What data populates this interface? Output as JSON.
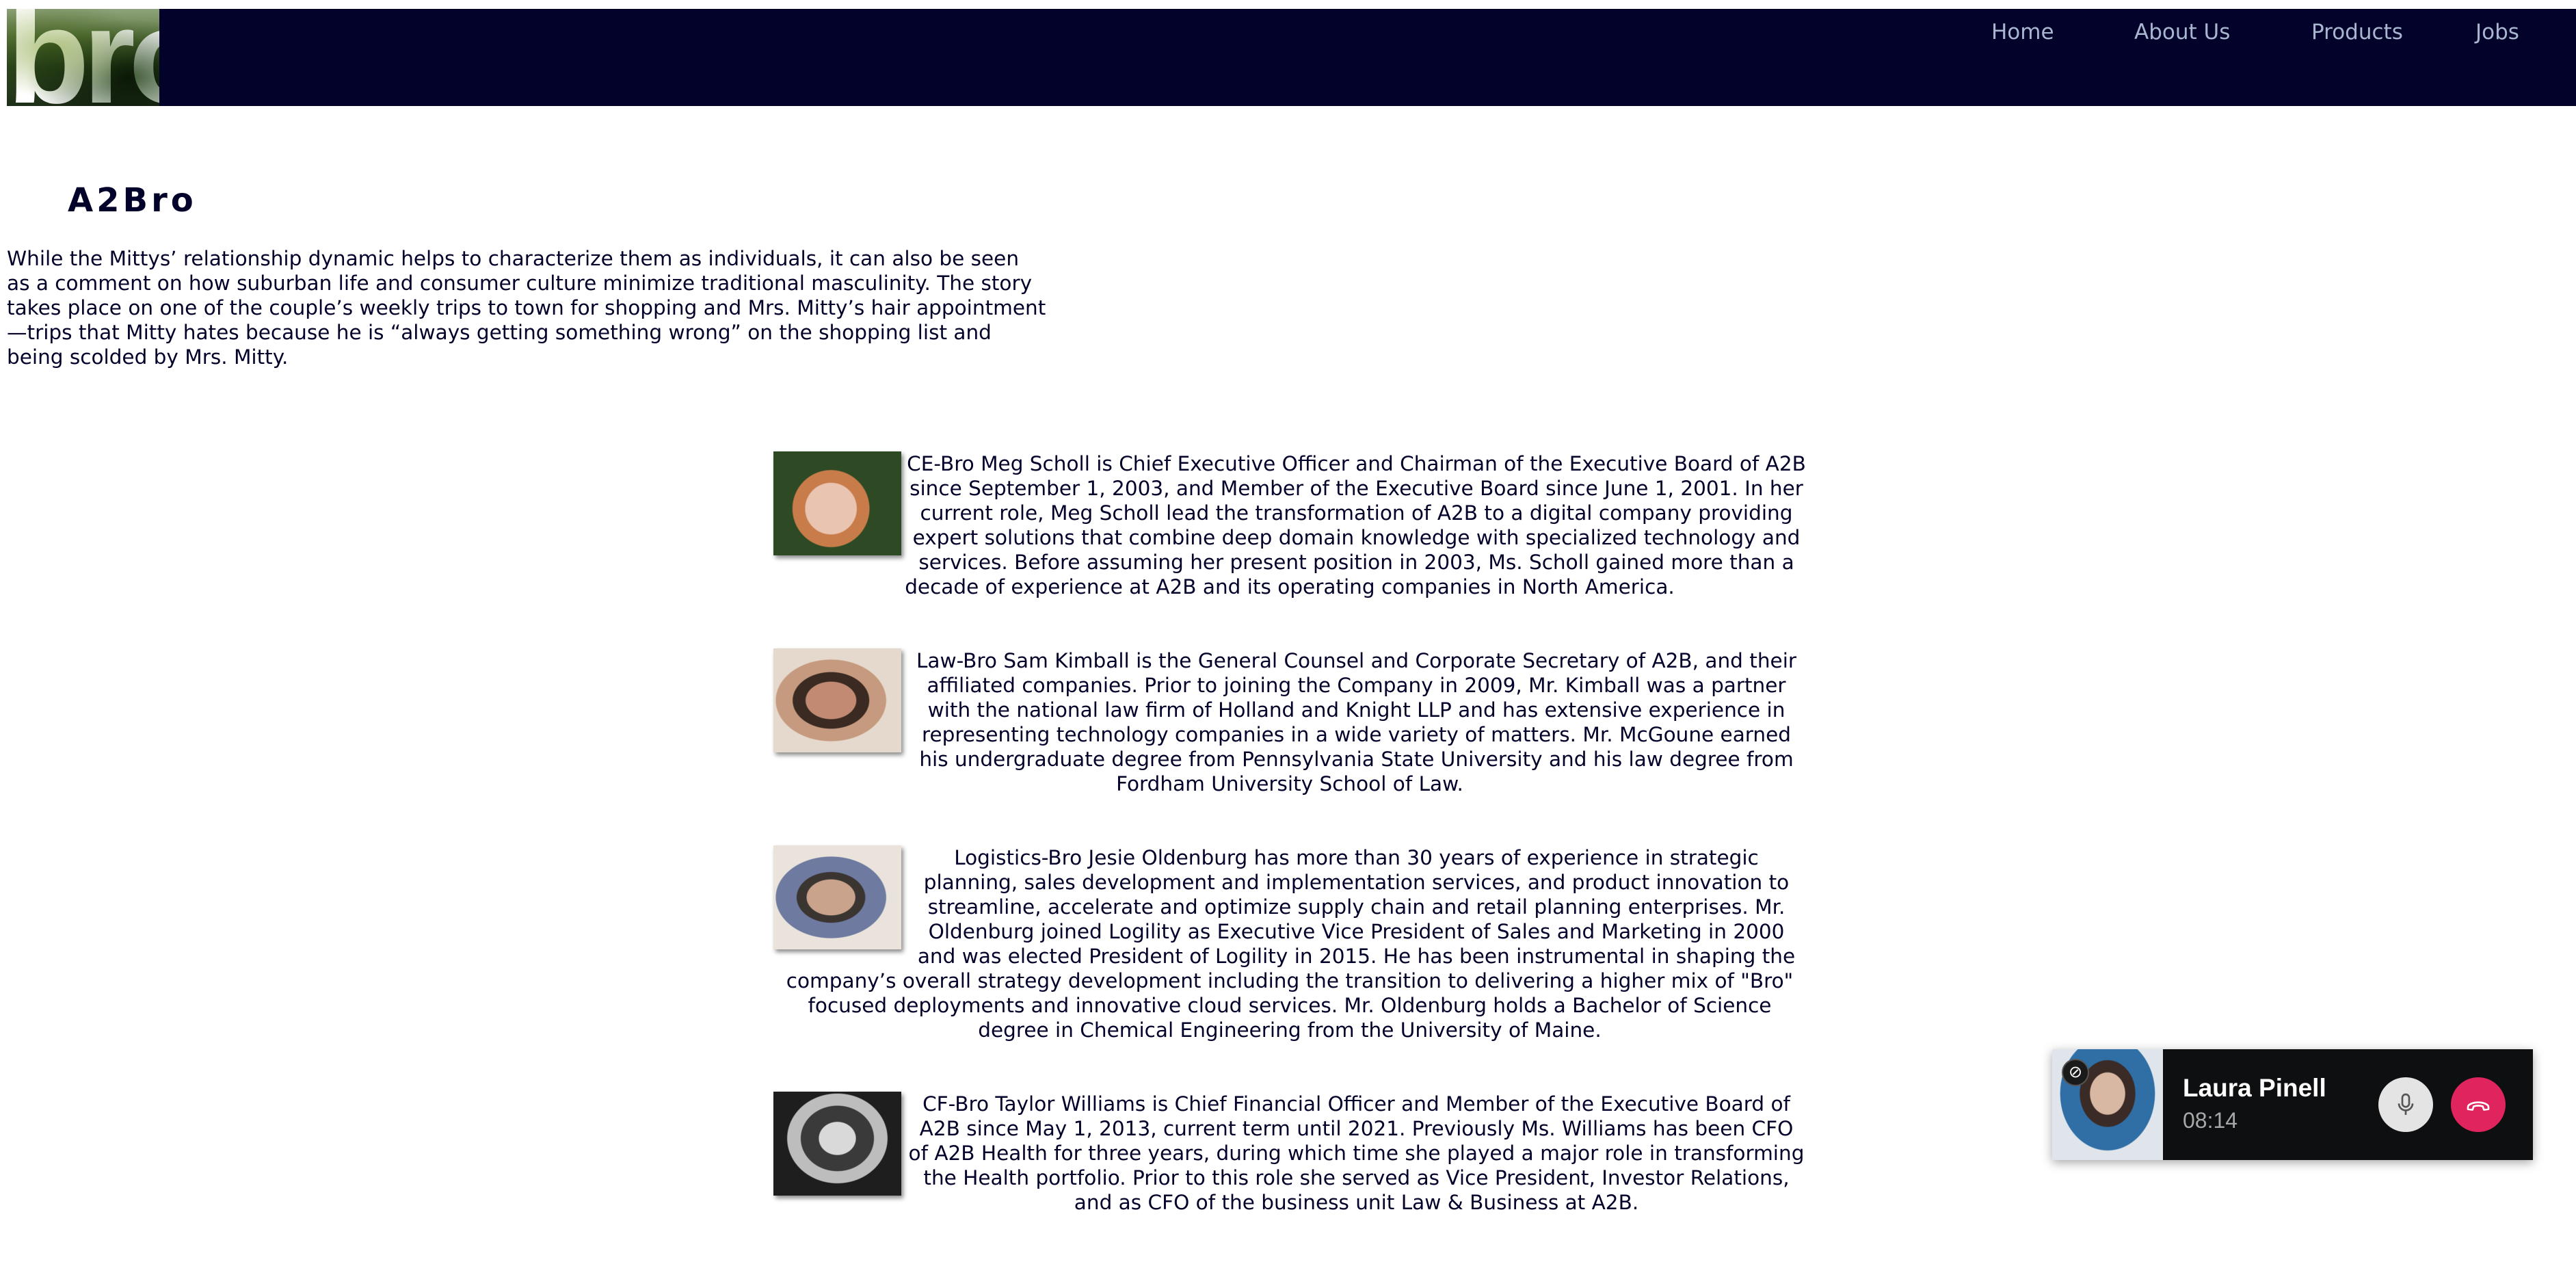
{
  "header": {
    "logo_text": "bro.",
    "nav": [
      {
        "label": "Home"
      },
      {
        "label": "About Us"
      },
      {
        "label": "Products"
      },
      {
        "label": "Jobs"
      }
    ]
  },
  "intro": {
    "title": "A2Bro",
    "text": "While the Mittys’ relationship dynamic helps to characterize them as individuals, it can also be seen as a comment on how suburban life and consumer culture minimize traditional masculinity. The story takes place on one of the couple’s weekly trips to town for shopping and Mrs. Mitty’s hair appointment—trips that Mitty hates because he is “always getting something wrong” on the shopping list and being scolded by Mrs. Mitty."
  },
  "team": [
    {
      "bio": "CE-Bro Meg Scholl is Chief Executive Officer and Chairman of the Executive Board of A2B since September 1, 2003, and Member of the Executive Board since June 1, 2001. In her current role, Meg Scholl lead the transformation of A2B to a digital company providing expert solutions that combine deep domain knowledge with specialized technology and services. Before assuming her present position in 2003, Ms. Scholl gained more than a decade of experience at A2B and its operating companies in North America."
    },
    {
      "bio": "Law-Bro Sam Kimball is the General Counsel and Corporate Secretary of A2B, and their affiliated companies. Prior to joining the Company in 2009, Mr. Kimball was a partner with the national law firm of Holland and Knight LLP and has extensive experience in representing technology companies in a wide variety of matters. Mr. McGoune earned his undergraduate degree from Pennsylvania State University and his law degree from Fordham University School of Law."
    },
    {
      "bio": "Logistics-Bro Jesie Oldenburg has more than 30 years of experience in strategic planning, sales development and implementation services, and product innovation to streamline, accelerate and optimize supply chain and retail planning enterprises. Mr. Oldenburg joined Logility as Executive Vice President of Sales and Marketing in 2000 and was elected President of Logility in 2015. He has been instrumental in shaping the company’s overall strategy development including the transition to delivering a higher mix of \"Bro\" focused deployments and innovative cloud services. Mr. Oldenburg holds a Bachelor of Science degree in Chemical Engineering from the University of Maine."
    },
    {
      "bio": "CF-Bro Taylor Williams is Chief Financial Officer and Member of the Executive Board of A2B since May 1, 2013, current term until 2021. Previously Ms. Williams has been CFO of A2B Health for three years, during which time she played a major role in transforming the Health portfolio. Prior to this role she served as Vice President, Investor Relations, and as CFO of the business unit Law & Business at A2B."
    }
  ],
  "call": {
    "caller_name": "Laura Pinell",
    "duration": "08:14",
    "close_glyph": "⊘"
  }
}
